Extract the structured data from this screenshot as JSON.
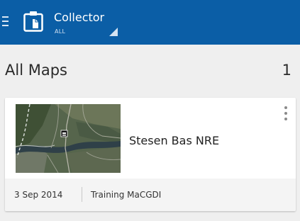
{
  "appbar": {
    "title": "Collector",
    "subtitle": "ALL",
    "background": "#0b5ea6"
  },
  "icons": {
    "menu": "hamburger-menu-icon",
    "app": "collector-app-icon",
    "dropdown": "dropdown-triangle-icon",
    "more": "more-vert-icon"
  },
  "section": {
    "title": "All Maps",
    "count": "1"
  },
  "maps": [
    {
      "title": "Stesen Bas NRE",
      "date": "3 Sep 2014",
      "group": "Training MaCGDI",
      "thumbnail": "satellite-imagery"
    }
  ]
}
